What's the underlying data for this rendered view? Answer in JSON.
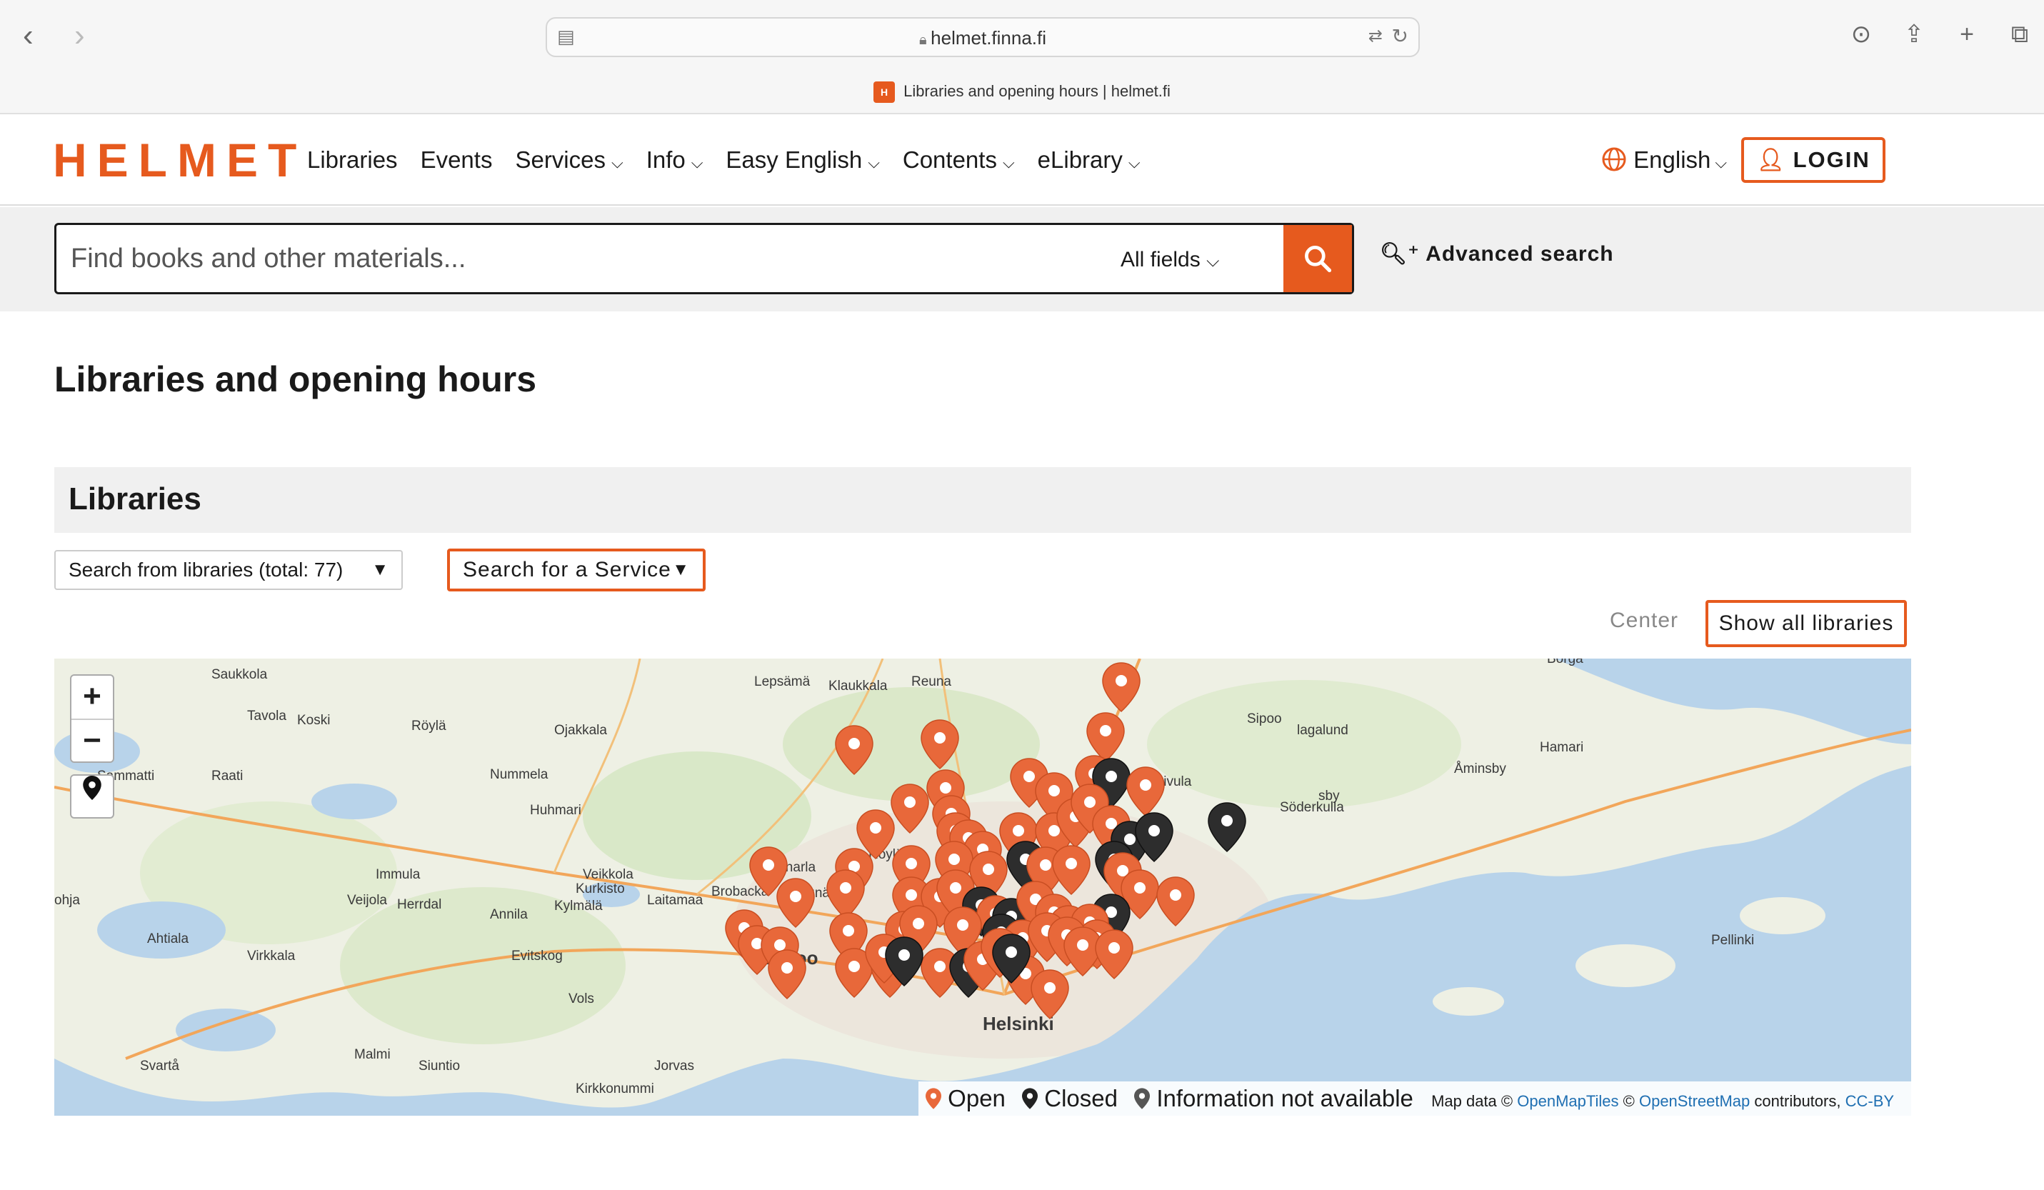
{
  "browser": {
    "url": "helmet.finna.fi",
    "tab_title": "Libraries and opening hours | helmet.fi",
    "tab_favicon": "H"
  },
  "header": {
    "logo": "HELMET",
    "menu": [
      {
        "label": "Libraries",
        "dropdown": false
      },
      {
        "label": "Events",
        "dropdown": false
      },
      {
        "label": "Services",
        "dropdown": true
      },
      {
        "label": "Info",
        "dropdown": true
      },
      {
        "label": "Easy English",
        "dropdown": true
      },
      {
        "label": "Contents",
        "dropdown": true
      },
      {
        "label": "eLibrary",
        "dropdown": true
      }
    ],
    "language": "English",
    "login": "LOGIN"
  },
  "search": {
    "placeholder": "Find books and other materials...",
    "field_select": "All fields",
    "advanced": "Advanced search"
  },
  "page": {
    "title": "Libraries and opening hours",
    "section_title": "Libraries",
    "library_select": "Search from libraries (total: 77)",
    "service_select": "Search for a Service",
    "center": "Center",
    "show_all": "Show all libraries"
  },
  "map": {
    "zoom_in": "+",
    "zoom_out": "−",
    "legend": {
      "open": "Open",
      "closed": "Closed",
      "na": "Information not available"
    },
    "attribution": {
      "prefix": "Map data ©",
      "omt": "OpenMapTiles",
      "sep": "©",
      "osm": "OpenStreetMap",
      "contributors": "contributors,",
      "license": "CC-BY"
    },
    "place_labels": [
      "Saukkola",
      "Tavola",
      "Koski",
      "Röylä",
      "Nummela",
      "Ojakkala",
      "Lepsämä",
      "Klaukkala",
      "Reuna",
      "Sipoo",
      "Hamari",
      "Sammatti",
      "Raati",
      "Huhmari",
      "Röylä",
      "Koivula",
      "Åminsby",
      "Söderkulla",
      "Immula",
      "Veikkola",
      "Kunnarla",
      "Kurkisto",
      "Brobacka",
      "Hognäs",
      "Laitamaa",
      "Veijola",
      "Herrdal",
      "Kylmälä",
      "Annila",
      "Ahtiala",
      "Virkkala",
      "Evitskog",
      "Espoo",
      "Vols",
      "Helsinki",
      "Svartå",
      "Malmi",
      "Siuntio",
      "Jorvas",
      "Kirkkonummi",
      "Pellinki",
      "sby",
      "Borgå",
      "ohja",
      "lagalund"
    ],
    "colors": {
      "open": "#e8683a",
      "closed": "#333333",
      "na": "#555555"
    }
  }
}
